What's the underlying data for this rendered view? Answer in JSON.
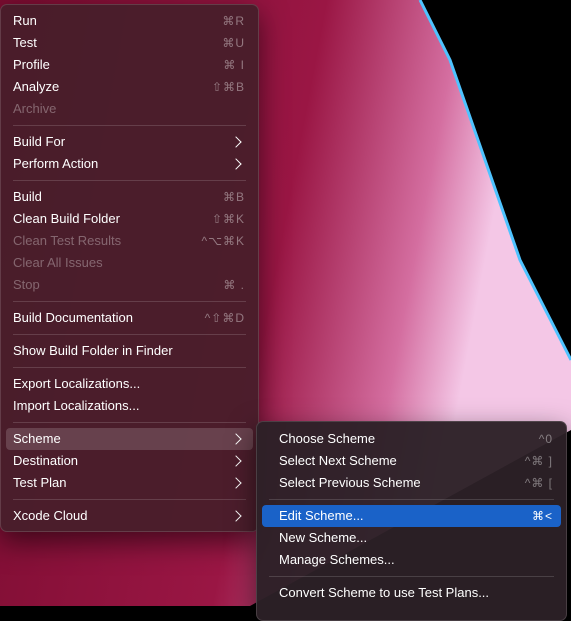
{
  "main_menu": {
    "groups": [
      [
        {
          "label": "Run",
          "shortcut": "⌘R"
        },
        {
          "label": "Test",
          "shortcut": "⌘U"
        },
        {
          "label": "Profile",
          "shortcut": "⌘ I"
        },
        {
          "label": "Analyze",
          "shortcut": "⇧⌘B"
        },
        {
          "label": "Archive",
          "shortcut": ""
        }
      ],
      [
        {
          "label": "Build For"
        },
        {
          "label": "Perform Action"
        }
      ],
      [
        {
          "label": "Build",
          "shortcut": "⌘B"
        },
        {
          "label": "Clean Build Folder",
          "shortcut": "⇧⌘K"
        },
        {
          "label": "Clean Test Results",
          "shortcut": "^⌥⌘K"
        },
        {
          "label": "Clear All Issues",
          "shortcut": ""
        },
        {
          "label": "Stop",
          "shortcut": "⌘ ."
        }
      ],
      [
        {
          "label": "Build Documentation",
          "shortcut": "^⇧⌘D"
        }
      ],
      [
        {
          "label": "Show Build Folder in Finder"
        }
      ],
      [
        {
          "label": "Export Localizations..."
        },
        {
          "label": "Import Localizations..."
        }
      ],
      [
        {
          "label": "Scheme"
        },
        {
          "label": "Destination"
        },
        {
          "label": "Test Plan"
        }
      ],
      [
        {
          "label": "Xcode Cloud"
        }
      ]
    ]
  },
  "scheme_submenu": {
    "groups": [
      [
        {
          "label": "Choose Scheme",
          "shortcut": "^0"
        },
        {
          "label": "Select Next Scheme",
          "shortcut": "^⌘ ]"
        },
        {
          "label": "Select Previous Scheme",
          "shortcut": "^⌘ ["
        }
      ],
      [
        {
          "label": "Edit Scheme...",
          "shortcut": "⌘<"
        },
        {
          "label": "New Scheme...",
          "shortcut": ""
        },
        {
          "label": "Manage Schemes...",
          "shortcut": ""
        }
      ],
      [
        {
          "label": "Convert Scheme to use Test Plans...",
          "shortcut": ""
        }
      ]
    ]
  },
  "colors": {
    "highlight": "#1a62c8",
    "menu_bg": "#46202a"
  }
}
